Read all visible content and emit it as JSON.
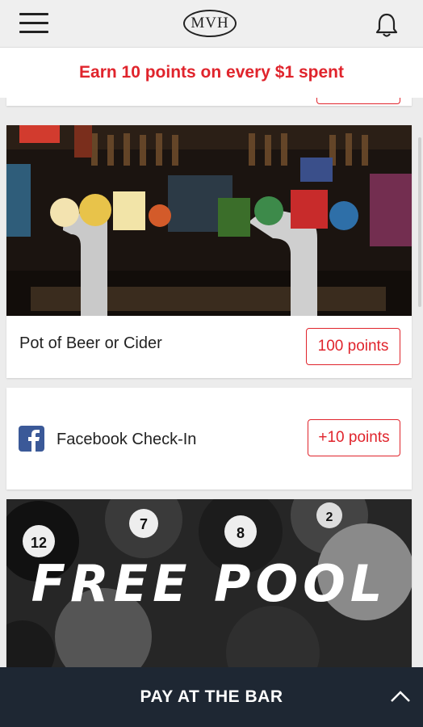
{
  "header": {
    "menu_icon": "hamburger-menu-icon",
    "logo_text": "MVH",
    "bell_icon": "bell-icon"
  },
  "promo": {
    "text": "Earn 10 points on every $1 spent"
  },
  "rewards": [
    {
      "title": "Pot of Beer or Cider",
      "points": "100 points",
      "image": "bar-beer-taps"
    }
  ],
  "checkin": {
    "icon": "facebook-icon",
    "label": "Facebook Check-In",
    "points": "+10 points"
  },
  "promo_image": {
    "image": "pool-balls",
    "text": "FREE POOL"
  },
  "paybar": {
    "label": "PAY AT THE BAR",
    "icon": "chevron-up-icon"
  },
  "colors": {
    "accent": "#e0242c",
    "paybar": "#1e2733",
    "facebook": "#3b5998"
  }
}
